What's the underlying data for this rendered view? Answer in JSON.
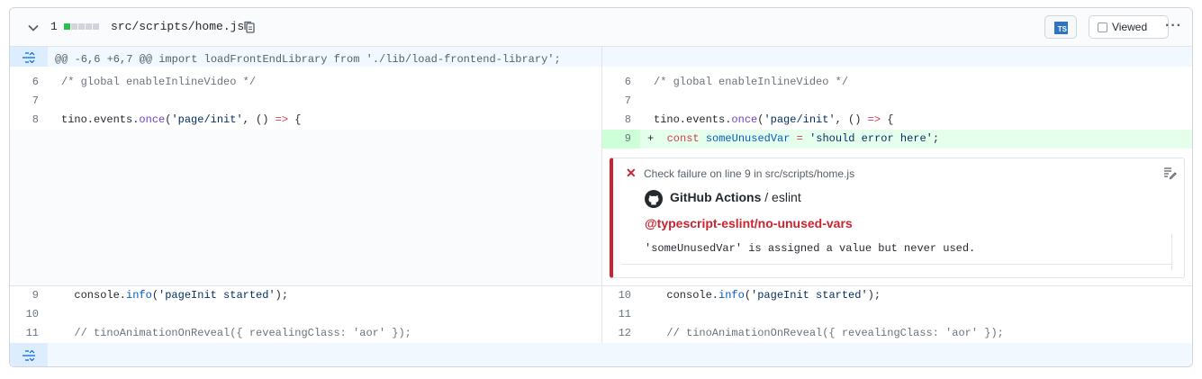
{
  "file_header": {
    "change_count": "1",
    "diffstat": [
      "add",
      "neutral",
      "neutral",
      "neutral",
      "neutral"
    ],
    "file_name": "src/scripts/home.js",
    "ts_badge": "TS",
    "viewed_label": "Viewed",
    "more_label": "···"
  },
  "hunk": {
    "text": "@@ -6,6 +6,7 @@ import loadFrontEndLibrary from './lib/load-frontend-library';"
  },
  "left_lines": [
    {
      "num": "6",
      "code": "/* global enableInlineVideo */"
    },
    {
      "num": "7",
      "code": ""
    },
    {
      "num": "8",
      "code": "tino.events.once('page/init', () => {"
    },
    {
      "num": "9",
      "code": "  console.info('pageInit started');"
    },
    {
      "num": "10",
      "code": ""
    },
    {
      "num": "11",
      "code": "  // tinoAnimationOnReveal({ revealingClass: 'aor' });"
    }
  ],
  "right_lines": [
    {
      "num": "6",
      "code": "/* global enableInlineVideo */"
    },
    {
      "num": "7",
      "code": ""
    },
    {
      "num": "8",
      "code": "tino.events.once('page/init', () => {"
    },
    {
      "num": "9",
      "code": "+  const someUnusedVar = 'should error here';"
    },
    {
      "num": "10",
      "code": "  console.info('pageInit started');"
    },
    {
      "num": "11",
      "code": ""
    },
    {
      "num": "12",
      "code": "  // tinoAnimationOnReveal({ revealingClass: 'aor' });"
    }
  ],
  "annotation": {
    "title": "Check failure on line 9 in src/scripts/home.js",
    "source_app": "GitHub Actions",
    "source_sep": " / ",
    "source_job": "eslint",
    "rule": "@typescript-eslint/no-unused-vars",
    "message": "'someUnusedVar' is assigned a value but never used."
  },
  "colors": {
    "added_bg": "#e6ffed",
    "added_num_bg": "#cdffd8",
    "hunk_bg": "#f1f8ff",
    "failure": "#cb2431",
    "keyword": "#d73a49",
    "function": "#6f42c1",
    "string": "#032f62"
  },
  "icons": [
    "chevron-down-icon",
    "copy-icon",
    "typescript-icon",
    "kebab-icon",
    "unfold-icon",
    "x-icon",
    "edit-note-icon",
    "github-mark-icon"
  ]
}
